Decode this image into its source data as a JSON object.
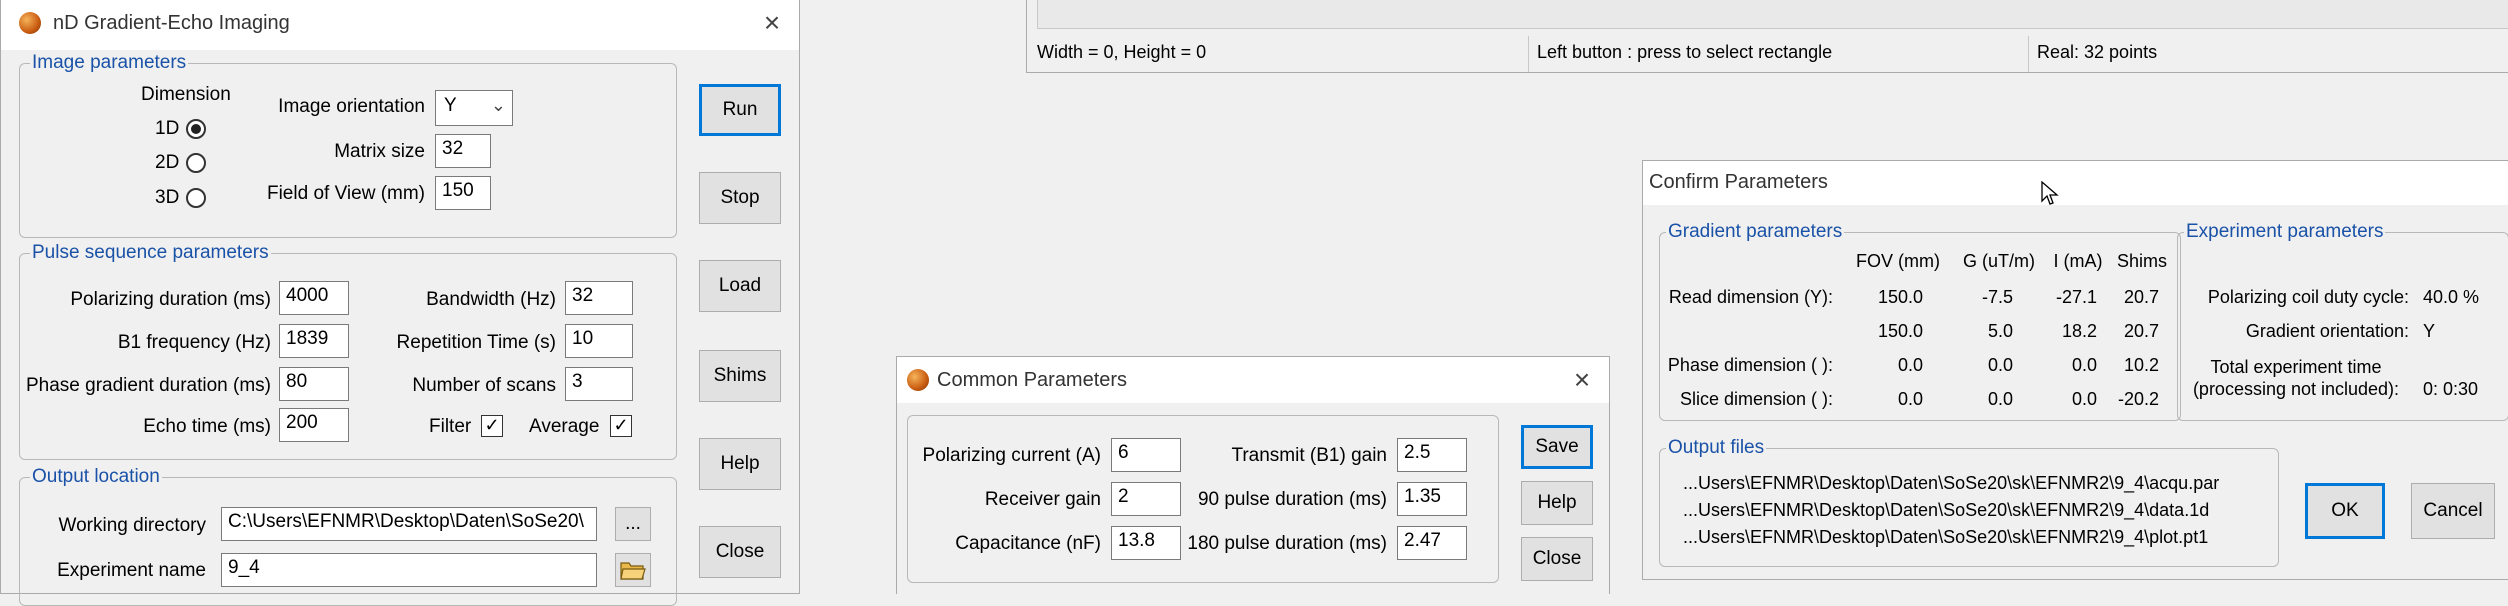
{
  "gradient_window": {
    "title": "nD Gradient-Echo Imaging",
    "image_params": {
      "legend": "Image parameters",
      "dimension_label": "Dimension",
      "dim_1d": "1D",
      "dim_2d": "2D",
      "dim_3d": "3D",
      "selected_dimension": "1D",
      "orientation_label": "Image orientation",
      "orientation_value": "Y",
      "matrix_label": "Matrix size",
      "matrix_value": "32",
      "fov_label": "Field of View (mm)",
      "fov_value": "150"
    },
    "pulse_params": {
      "legend": "Pulse sequence parameters",
      "polarizing_label": "Polarizing duration (ms)",
      "polarizing_value": "4000",
      "b1_label": "B1 frequency (Hz)",
      "b1_value": "1839",
      "phase_label": "Phase gradient duration (ms)",
      "phase_value": "80",
      "echo_label": "Echo time (ms)",
      "echo_value": "200",
      "bandwidth_label": "Bandwidth (Hz)",
      "bandwidth_value": "32",
      "rep_label": "Repetition Time (s)",
      "rep_value": "10",
      "scans_label": "Number of scans",
      "scans_value": "3",
      "filter_label": "Filter",
      "filter_checked": true,
      "average_label": "Average",
      "average_checked": true
    },
    "output": {
      "legend": "Output location",
      "workdir_label": "Working directory",
      "workdir_value": "C:\\Users\\EFNMR\\Desktop\\Daten\\SoSe20\\",
      "browse_label": "...",
      "expname_label": "Experiment name",
      "expname_value": "9_4"
    },
    "buttons": {
      "run": "Run",
      "stop": "Stop",
      "load": "Load",
      "shims": "Shims",
      "help": "Help",
      "close": "Close"
    }
  },
  "status_bar": {
    "size_text": "Width =  0, Height =  0",
    "hint_text": "Left button : press to select rectangle",
    "real_text": "Real: 32 points"
  },
  "common_window": {
    "title": "Common Parameters",
    "polarizing_current_label": "Polarizing current (A)",
    "polarizing_current_value": "6",
    "receiver_gain_label": "Receiver gain",
    "receiver_gain_value": "2",
    "capacitance_label": "Capacitance (nF)",
    "capacitance_value": "13.8",
    "transmit_gain_label": "Transmit (B1) gain",
    "transmit_gain_value": "2.5",
    "pulse90_label": "90 pulse duration (ms)",
    "pulse90_value": "1.35",
    "pulse180_label": "180 pulse duration (ms)",
    "pulse180_value": "2.47",
    "buttons": {
      "save": "Save",
      "help": "Help",
      "close": "Close"
    }
  },
  "confirm_window": {
    "title": "Confirm Parameters",
    "gradient": {
      "legend": "Gradient parameters",
      "columns": [
        "FOV (mm)",
        "G (uT/m)",
        "I (mA)",
        "Shims"
      ],
      "rows": [
        {
          "label": "Read dimension (Y):",
          "values": [
            "150.0",
            "-7.5",
            "-27.1",
            "20.7"
          ]
        },
        {
          "label": "",
          "values": [
            "150.0",
            "5.0",
            "18.2",
            "20.7"
          ]
        },
        {
          "label": "Phase dimension ( ):",
          "values": [
            "0.0",
            "0.0",
            "0.0",
            "10.2"
          ]
        },
        {
          "label": "Slice dimension ( ):",
          "values": [
            "0.0",
            "0.0",
            "0.0",
            "-20.2"
          ]
        }
      ]
    },
    "experiment": {
      "legend": "Experiment parameters",
      "duty_label": "Polarizing coil duty cycle:",
      "duty_value": "40.0 %",
      "orientation_label": "Gradient orientation:",
      "orientation_value": "Y",
      "total_label_1": "Total experiment time",
      "total_label_2": "(processing not included):",
      "total_value": "0: 0:30"
    },
    "output": {
      "legend": "Output files",
      "files": [
        "...Users\\EFNMR\\Desktop\\Daten\\SoSe20\\sk\\EFNMR2\\9_4\\acqu.par",
        "...Users\\EFNMR\\Desktop\\Daten\\SoSe20\\sk\\EFNMR2\\9_4\\data.1d",
        "...Users\\EFNMR\\Desktop\\Daten\\SoSe20\\sk\\EFNMR2\\9_4\\plot.pt1"
      ]
    },
    "buttons": {
      "ok": "OK",
      "cancel": "Cancel"
    }
  }
}
